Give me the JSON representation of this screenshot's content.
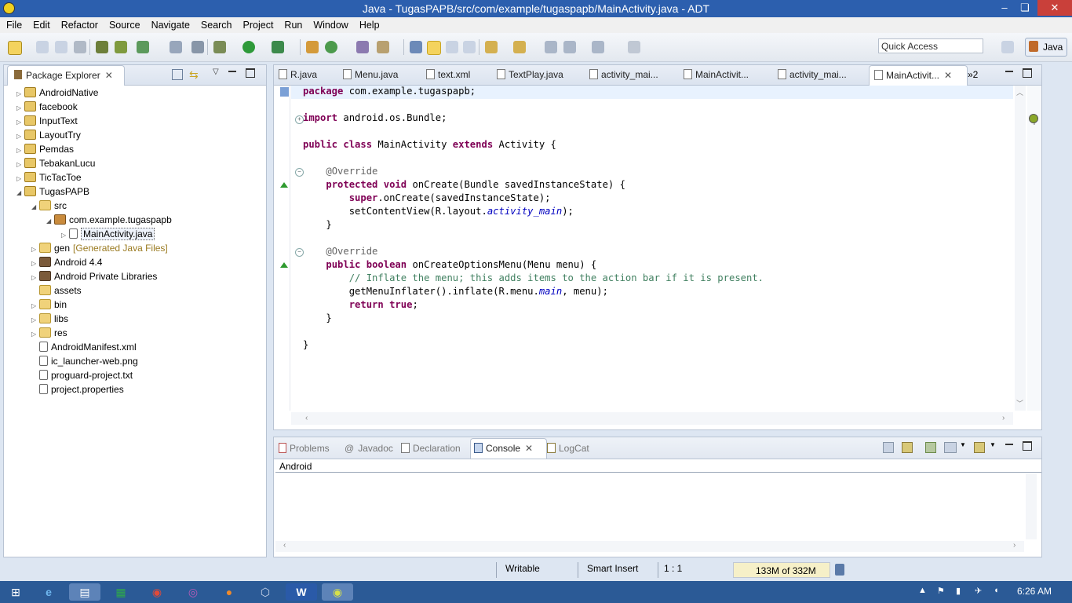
{
  "window": {
    "title": "Java - TugasPAPB/src/com/example/tugaspapb/MainActivity.java - ADT",
    "minimize": "–",
    "restore": "❏",
    "close": "✕"
  },
  "menu": [
    "File",
    "Edit",
    "Refactor",
    "Source",
    "Navigate",
    "Search",
    "Project",
    "Run",
    "Window",
    "Help"
  ],
  "toolbar": {
    "quick_access": "Quick Access",
    "perspective": "Java"
  },
  "package_explorer": {
    "title": "Package Explorer",
    "items": [
      {
        "label": "AndroidNative",
        "level": 0,
        "icon": "project-icon",
        "twist": "closed"
      },
      {
        "label": "facebook",
        "level": 0,
        "icon": "project-icon",
        "twist": "closed"
      },
      {
        "label": "InputText",
        "level": 0,
        "icon": "project-icon",
        "twist": "closed"
      },
      {
        "label": "LayoutTry",
        "level": 0,
        "icon": "project-icon",
        "twist": "closed"
      },
      {
        "label": "Pemdas",
        "level": 0,
        "icon": "project-icon",
        "twist": "closed"
      },
      {
        "label": "TebakanLucu",
        "level": 0,
        "icon": "project-icon",
        "twist": "closed"
      },
      {
        "label": "TicTacToe",
        "level": 0,
        "icon": "project-icon",
        "twist": "closed"
      },
      {
        "label": "TugasPAPB",
        "level": 0,
        "icon": "project-icon",
        "twist": "open"
      },
      {
        "label": "src",
        "level": 1,
        "icon": "folder-icon",
        "twist": "open"
      },
      {
        "label": "com.example.tugaspapb",
        "level": 2,
        "icon": "package-icon",
        "twist": "open"
      },
      {
        "label": "MainActivity.java",
        "level": 3,
        "icon": "java-file-icon",
        "twist": "closed",
        "selected": true
      },
      {
        "label": "gen",
        "decoration": "[Generated Java Files]",
        "level": 1,
        "icon": "folder-icon",
        "twist": "closed"
      },
      {
        "label": "Android 4.4",
        "level": 1,
        "icon": "library-icon",
        "twist": "closed"
      },
      {
        "label": "Android Private Libraries",
        "level": 1,
        "icon": "library-icon",
        "twist": "closed"
      },
      {
        "label": "assets",
        "level": 1,
        "icon": "folder-icon",
        "twist": "none"
      },
      {
        "label": "bin",
        "level": 1,
        "icon": "folder-icon",
        "twist": "closed"
      },
      {
        "label": "libs",
        "level": 1,
        "icon": "folder-icon",
        "twist": "closed"
      },
      {
        "label": "res",
        "level": 1,
        "icon": "folder-icon",
        "twist": "closed"
      },
      {
        "label": "AndroidManifest.xml",
        "level": 1,
        "icon": "xml-file-icon",
        "twist": "none"
      },
      {
        "label": "ic_launcher-web.png",
        "level": 1,
        "icon": "image-file-icon",
        "twist": "none"
      },
      {
        "label": "proguard-project.txt",
        "level": 1,
        "icon": "text-file-icon",
        "twist": "none"
      },
      {
        "label": "project.properties",
        "level": 1,
        "icon": "text-file-icon",
        "twist": "none"
      }
    ]
  },
  "editor": {
    "tabs": [
      "R.java",
      "Menu.java",
      "text.xml",
      "TextPlay.java",
      "activity_mai...",
      "MainActivit...",
      "activity_mai...",
      "MainActivit..."
    ],
    "overflow": "»2",
    "active_tab": 7
  },
  "console": {
    "tabs": [
      "Problems",
      "Javadoc",
      "Declaration",
      "Console",
      "LogCat"
    ],
    "active_tab": 3,
    "header": "Android"
  },
  "status": {
    "writable": "Writable",
    "insert_mode": "Smart Insert",
    "position": "1 : 1",
    "memory": "133M of 332M"
  },
  "taskbar": {
    "clock": "6:26 AM"
  }
}
